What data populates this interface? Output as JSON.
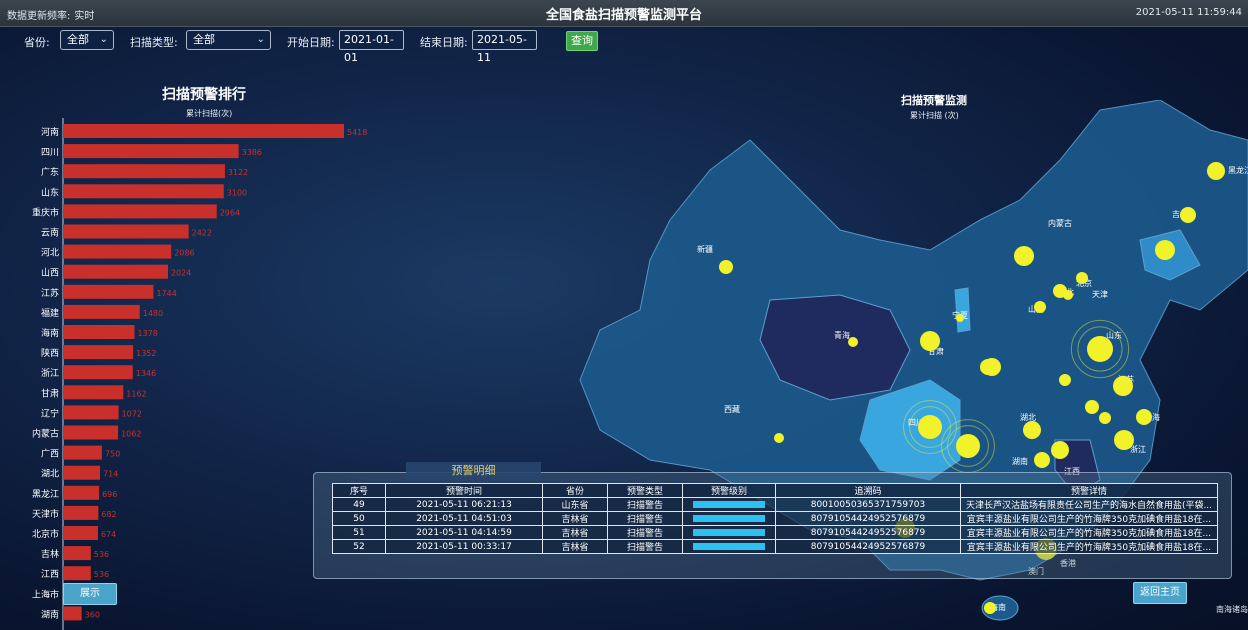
{
  "header": {
    "freq_label": "数据更新频率:",
    "freq_value": "实时",
    "title": "全国食盐扫描预警监测平台",
    "clock": "2021-05-11 11:59:44"
  },
  "filters": {
    "province_label": "省份:",
    "province_value": "全部",
    "scan_type_label": "扫描类型:",
    "scan_type_value": "全部",
    "start_label": "开始日期:",
    "start_value": "2021-01-01",
    "end_label": "结束日期:",
    "end_value": "2021-05-11",
    "query_label": "查询"
  },
  "ranking": {
    "title": "扫描预警排行",
    "subtitle": "累计扫描(次)"
  },
  "map": {
    "title": "扫描预警监测",
    "subtitle": "累计扫描 (次)",
    "labels": [
      "黑龙江",
      "吉林",
      "内蒙古",
      "辽宁",
      "新疆",
      "北京",
      "天津",
      "河北",
      "山西",
      "宁夏",
      "山东",
      "青海",
      "甘肃",
      "陕西",
      "江苏",
      "西藏",
      "四川",
      "湖北",
      "上海",
      "浙江",
      "湖南",
      "江西",
      "澳门",
      "香港",
      "海南"
    ],
    "land_color": "#1c5a8c",
    "highlight_color": "#3aa6e0",
    "dark_color": "#1f2a5e",
    "dot_color": "#f2f22a",
    "nanhai_label": "南海诸岛"
  },
  "detail": {
    "tab": "预警明细",
    "columns": [
      "序号",
      "预警时间",
      "省份",
      "预警类型",
      "预警级别",
      "追溯码",
      "预警详情"
    ],
    "rows": [
      {
        "no": "49",
        "time": "2021-05-11 06:21:13",
        "province": "山东省",
        "type": "扫描警告",
        "code": "80010050365371759703",
        "detail": "天津长芦汉沽盐场有限责任公司生产的海水自然食用盐(平袋..."
      },
      {
        "no": "50",
        "time": "2021-05-11 04:51:03",
        "province": "吉林省",
        "type": "扫描警告",
        "code": "80791054424952576879",
        "detail": "宜宾丰源盐业有限公司生产的竹海牌350克加碘食用盐18在..."
      },
      {
        "no": "51",
        "time": "2021-05-11 04:14:59",
        "province": "吉林省",
        "type": "扫描警告",
        "code": "80791054424952576879",
        "detail": "宜宾丰源盐业有限公司生产的竹海牌350克加碘食用盐18在..."
      },
      {
        "no": "52",
        "time": "2021-05-11 00:33:17",
        "province": "吉林省",
        "type": "扫描警告",
        "code": "80791054424952576879",
        "detail": "宜宾丰源盐业有限公司生产的竹海牌350克加碘食用盐18在..."
      }
    ]
  },
  "buttons": {
    "show": "展示",
    "back": "返回主页"
  },
  "chart_data": {
    "type": "bar",
    "orientation": "horizontal",
    "title": "扫描预警排行",
    "xlabel": "累计扫描(次)",
    "categories": [
      "河南",
      "四川",
      "广东",
      "山东",
      "重庆市",
      "云南",
      "河北",
      "山西",
      "江苏",
      "福建",
      "海南",
      "陕西",
      "浙江",
      "甘肃",
      "辽宁",
      "内蒙古",
      "广西",
      "湖北",
      "黑龙江",
      "天津市",
      "北京市",
      "吉林",
      "江西",
      "上海市",
      "湖南"
    ],
    "values": [
      5418,
      3386,
      3122,
      3100,
      2964,
      2422,
      2086,
      2024,
      1744,
      1480,
      1378,
      1352,
      1346,
      1162,
      1072,
      1062,
      750,
      714,
      696,
      682,
      674,
      536,
      536,
      null,
      360
    ],
    "bar_color": "#c9302c",
    "label_color": "#c9302c",
    "xlim": [
      0,
      5418
    ]
  }
}
